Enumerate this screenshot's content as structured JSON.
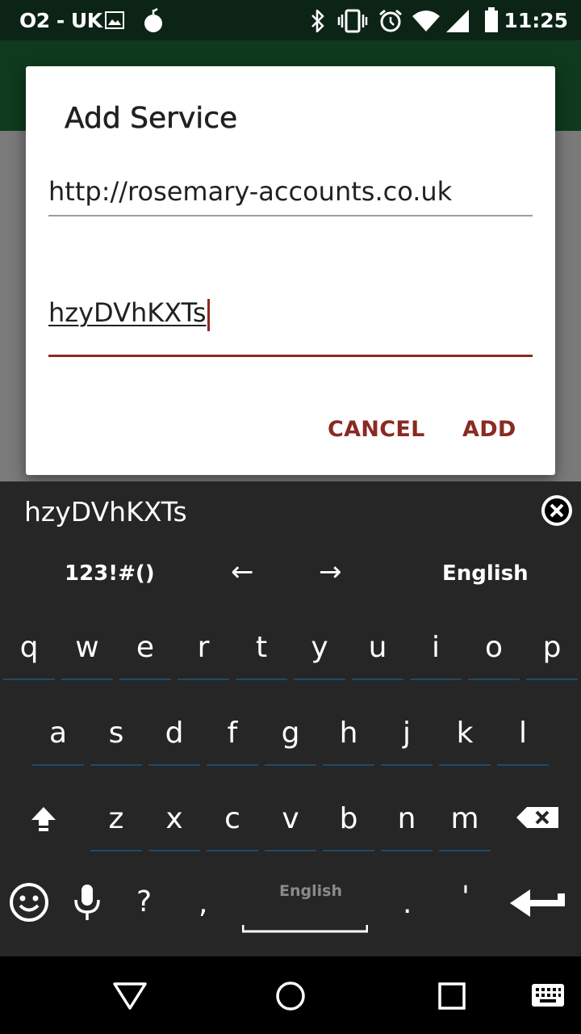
{
  "status_bar": {
    "carrier": "O2 - UK",
    "time": "11:25",
    "icons": [
      "image-icon",
      "apple-icon",
      "bluetooth-icon",
      "vibrate-icon",
      "alarm-icon",
      "wifi-icon",
      "signal-icon",
      "battery-icon"
    ]
  },
  "dialog": {
    "title": "Add Service",
    "url_value": "http://rosemary-accounts.co.uk",
    "key_value": "hzyDVhKXTs",
    "cancel_label": "CANCEL",
    "add_label": "ADD",
    "accent_color": "#8b2a22"
  },
  "keyboard": {
    "suggestion": "hzyDVhKXTs",
    "symbols_label": "123!#()",
    "left_arrow": "←",
    "right_arrow": "→",
    "language_label": "English",
    "space_label": "English",
    "row1": [
      "q",
      "w",
      "e",
      "r",
      "t",
      "y",
      "u",
      "i",
      "o",
      "p"
    ],
    "row2": [
      "a",
      "s",
      "d",
      "f",
      "g",
      "h",
      "j",
      "k",
      "l"
    ],
    "row3": [
      "z",
      "x",
      "c",
      "v",
      "b",
      "n",
      "m"
    ],
    "question": "?",
    "comma": ",",
    "period": ".",
    "apostrophe": "'"
  },
  "nav_bar": {
    "icons": [
      "back-icon",
      "home-icon",
      "recents-icon",
      "keyboard-switch-icon"
    ]
  }
}
